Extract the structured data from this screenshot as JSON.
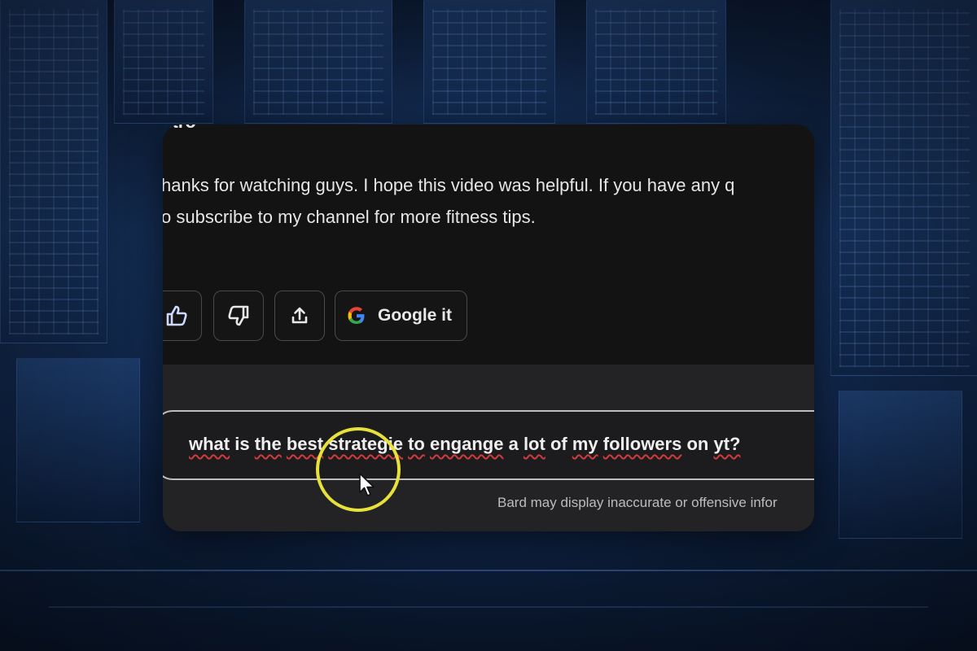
{
  "response": {
    "heading": "utro",
    "line1": "hanks for watching guys. I hope this video was helpful. If you have any q",
    "line2": "o subscribe to my channel for more fitness tips."
  },
  "actions": {
    "like_icon": "thumbs-up-icon",
    "dislike_icon": "thumbs-down-icon",
    "share_icon": "share-icon",
    "google_icon": "google-g-icon",
    "google_label": "Google it"
  },
  "prompt": {
    "words": [
      "what",
      "is",
      "the",
      "best",
      "strategie",
      "to",
      "engange",
      "a",
      "lot",
      "of",
      "my",
      "followers",
      "on",
      "yt?"
    ],
    "misspelled": [
      0,
      2,
      3,
      4,
      5,
      6,
      8,
      10,
      11,
      13
    ]
  },
  "disclaimer": "Bard may display inaccurate or offensive infor",
  "overlay": {
    "highlight": "click-highlight-ring",
    "highlight_color": "#e6e23a",
    "cursor": "mouse-pointer-icon"
  },
  "colors": {
    "card_bg": "#131313",
    "input_bg": "#232325",
    "text": "#e6e6e6",
    "spell_underline": "#d23b3b"
  }
}
